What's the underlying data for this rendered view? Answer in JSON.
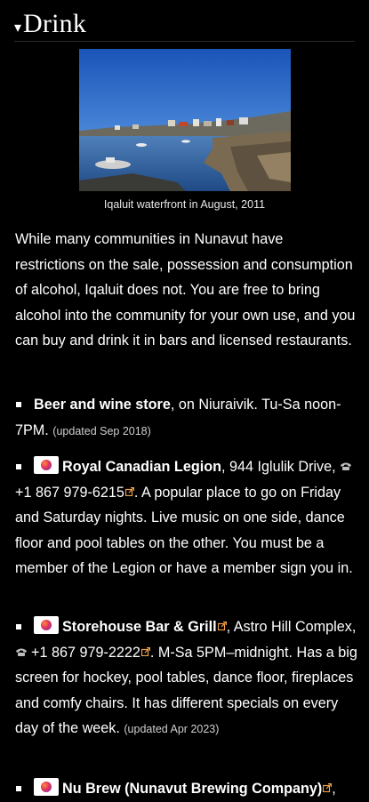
{
  "section": {
    "caret": "▾",
    "title": "Drink"
  },
  "photo": {
    "caption": "Iqaluit waterfront in August, 2011"
  },
  "intro": "While many communities in Nunavut have restrictions on the sale, possession and consumption of alcohol, Iqaluit does not. You are free to bring alcohol into the community for your own use, and you can buy and drink it in bars and licensed restaurants.",
  "listings": [
    {
      "name": "Beer and wine store",
      "details": ", on Niuraivik. Tu-Sa noon-7PM.",
      "updated": "(updated Sep 2018)"
    },
    {
      "name": "Royal Canadian Legion",
      "address": ", 944 Iglulik Drive,",
      "phone": "+1 867 979-6215",
      "details": ". A popular place to go on Friday and Saturday nights. Live music on one side, dance floor and pool tables on the other. You must be a member of the Legion or have a member sign you in."
    },
    {
      "name": "Storehouse Bar & Grill",
      "address": ", Astro Hill Complex,",
      "phone": "+1 867 979-2222",
      "details": ". M-Sa 5PM–midnight. Has a big screen for hockey, pool tables, dance floor, fireplaces and comfy chairs. It has different specials on every day of the week.",
      "updated": "(updated Apr 2023)"
    },
    {
      "name": "Nu Brew (Nunavut Brewing Company)",
      "details": ","
    }
  ],
  "colors": {
    "background": "#000000",
    "text": "#ffffff",
    "link_icon": "#f2a24a"
  }
}
